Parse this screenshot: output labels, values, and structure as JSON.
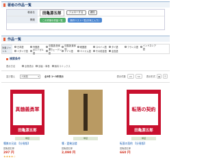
{
  "section1": {
    "title": "著者の作品一覧"
  },
  "author": {
    "label_name": "著者名",
    "name": "田亀源五郎",
    "fav_label": "フォローする",
    "fav_small": "通知",
    "label_links": "関連",
    "link1": "この作家の作品一覧",
    "link2": "新作リスト一覧(お気に入り)"
  },
  "section2": {
    "title": "作品一覧"
  },
  "filter": {
    "label": "対象ジャンル",
    "genres": [
      {
        "label": "日本語",
        "on": false
      },
      {
        "label": "外国語",
        "on": false
      },
      {
        "label": "中国語(簡体字)",
        "on": false
      },
      {
        "label": "中国語(繁体字)",
        "on": false
      },
      {
        "label": "韓国語",
        "on": false
      },
      {
        "label": "スペイン語",
        "on": false
      },
      {
        "label": "タイ語",
        "on": false
      },
      {
        "label": "フランス語",
        "on": false
      },
      {
        "label": "インドネシア語",
        "on": false
      },
      {
        "label": "イタリア語",
        "on": false
      },
      {
        "label": "ポルトガル語",
        "on": false
      },
      {
        "label": "スウェーデン語",
        "on": false
      },
      {
        "label": "ドイツ語",
        "on": false
      },
      {
        "label": "ベトナム語",
        "on": false
      },
      {
        "label": "その他言語",
        "on": false
      },
      {
        "label": "全言語",
        "on": true
      }
    ]
  },
  "subhead": "検索条件",
  "options": {
    "label": "表示方法",
    "opt1": "全巻表示",
    "opt2": "読者・単巻",
    "opt3": "無料コミックス"
  },
  "sort": {
    "label": "並び替え",
    "value": "人気順",
    "count_text": "全3件 1〜3件表示",
    "view_label": "表示件数",
    "v1": "20",
    "v2": "50",
    "show_label": "表示形式"
  },
  "books": [
    {
      "title": "嘆美の兄弟 【分冊版】",
      "author": "田亀源五郎",
      "price": "297 円",
      "tag": "単話",
      "stars": "★★★★☆",
      "cover_title": "真髄義勇軍",
      "cover_author": "田亀源五郎"
    },
    {
      "title": "嘆 : 愛幾念楼",
      "author": "田亀源五郎",
      "price": "2,090 円",
      "tag": "単話",
      "stars": "",
      "cover_title": "",
      "cover_author": ""
    },
    {
      "title": "転落の契約 【分冊版】",
      "author": "田亀源五郎",
      "price": "660 円",
      "tag": "単話",
      "stars": "",
      "cover_title": "転落の契約",
      "cover_author": "田亀源五郎"
    }
  ],
  "colors": {
    "accent": "#e8603c",
    "link": "#1a5fb4",
    "price": "#d1301e",
    "cover_red": "#c8102e"
  }
}
